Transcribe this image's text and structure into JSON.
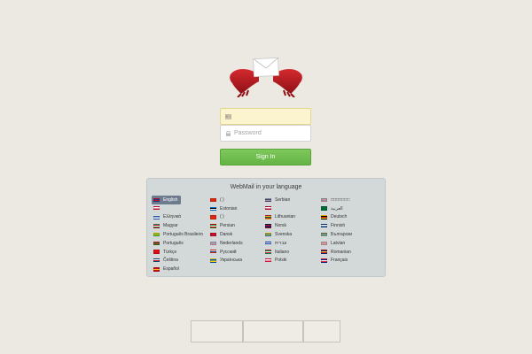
{
  "login": {
    "username_placeholder": "",
    "password_placeholder": "Password",
    "signin_label": "Sign In"
  },
  "languages": {
    "title": "WebMail in your language",
    "active": "English",
    "columns": [
      [
        {
          "label": "English",
          "flag": "uk-flag",
          "colors": [
            "#1f3a8a",
            "#c8102e"
          ]
        },
        {
          "label": "",
          "flag": "korea-flag",
          "colors": [
            "#ffffff",
            "#c8102e"
          ]
        },
        {
          "label": "Ελληνικά",
          "flag": "greece-flag",
          "colors": [
            "#1e5ab8",
            "#ffffff"
          ]
        },
        {
          "label": "Magyar",
          "flag": "hungary-flag",
          "colors": [
            "#c8102e",
            "#ffffff",
            "#3e8e41"
          ]
        },
        {
          "label": "Português Brasileiro",
          "flag": "brazil-flag",
          "colors": [
            "#1fa03c",
            "#f4d000"
          ]
        },
        {
          "label": "Português",
          "flag": "portugal-flag",
          "colors": [
            "#1a7f2a",
            "#d21f1f"
          ]
        },
        {
          "label": "Türkçe",
          "flag": "turkey-flag",
          "colors": [
            "#e30a17",
            "#e30a17"
          ]
        },
        {
          "label": "Čeština",
          "flag": "czech-flag",
          "colors": [
            "#ffffff",
            "#d7141a",
            "#11457e"
          ]
        },
        {
          "label": "Español",
          "flag": "spain-flag",
          "colors": [
            "#c60b1e",
            "#ffc400",
            "#c60b1e"
          ]
        }
      ],
      [
        {
          "label": "( )",
          "flag": "china-flag",
          "colors": [
            "#de2910",
            "#de2910"
          ]
        },
        {
          "label": "Estonian",
          "flag": "estonia-flag",
          "colors": [
            "#0072ce",
            "#000000",
            "#ffffff"
          ]
        },
        {
          "label": "( )",
          "flag": "china-flag",
          "colors": [
            "#de2910",
            "#de2910"
          ]
        },
        {
          "label": "Persian",
          "flag": "iran-flag",
          "colors": [
            "#239f40",
            "#ffffff",
            "#da0000"
          ]
        },
        {
          "label": "Dansk",
          "flag": "denmark-flag",
          "colors": [
            "#c8102e",
            "#c8102e"
          ]
        },
        {
          "label": "Nederlands",
          "flag": "netherlands-flag",
          "colors": [
            "#ae1c28",
            "#ffffff",
            "#21468b"
          ]
        },
        {
          "label": "Русский",
          "flag": "russia-flag",
          "colors": [
            "#ffffff",
            "#0039a6",
            "#d52b1e"
          ]
        },
        {
          "label": "Українська",
          "flag": "ukraine-flag",
          "colors": [
            "#0057b7",
            "#ffd700"
          ]
        }
      ],
      [
        {
          "label": "Serbian",
          "flag": "serbia-flag",
          "colors": [
            "#c6363c",
            "#0c4076",
            "#ffffff"
          ]
        },
        {
          "label": "",
          "flag": "japan-flag",
          "colors": [
            "#ffffff",
            "#bc002d"
          ]
        },
        {
          "label": "Lithuanian",
          "flag": "lithuania-flag",
          "colors": [
            "#fdb913",
            "#006a44",
            "#c1272d"
          ]
        },
        {
          "label": "Norsk",
          "flag": "norway-flag",
          "colors": [
            "#ba0c2f",
            "#00205b"
          ]
        },
        {
          "label": "Svenska",
          "flag": "sweden-flag",
          "colors": [
            "#006aa7",
            "#fecc00"
          ]
        },
        {
          "label": "עברית",
          "flag": "israel-flag",
          "colors": [
            "#ffffff",
            "#0038b8"
          ]
        },
        {
          "label": "Italiano",
          "flag": "italy-flag",
          "colors": [
            "#009246",
            "#ffffff",
            "#ce2b37"
          ]
        },
        {
          "label": "Polski",
          "flag": "poland-flag",
          "colors": [
            "#ffffff",
            "#dc143c"
          ]
        }
      ],
      [
        {
          "label": "□□□□□□□",
          "flag": "thailand-flag",
          "colors": [
            "#a51931",
            "#ffffff",
            "#2d2a4a"
          ]
        },
        {
          "label": "العربية",
          "flag": "arabic-flag",
          "colors": [
            "#006c35",
            "#006c35"
          ]
        },
        {
          "label": "Deutsch",
          "flag": "germany-flag",
          "colors": [
            "#000000",
            "#dd0000",
            "#ffce00"
          ]
        },
        {
          "label": "Finnish",
          "flag": "finland-flag",
          "colors": [
            "#ffffff",
            "#003580"
          ]
        },
        {
          "label": "Български",
          "flag": "bulgaria-flag",
          "colors": [
            "#ffffff",
            "#00966e",
            "#d62612"
          ]
        },
        {
          "label": "Latvian",
          "flag": "latvia-flag",
          "colors": [
            "#9e3039",
            "#ffffff",
            "#9e3039"
          ]
        },
        {
          "label": "Romanian",
          "flag": "romania-flag",
          "colors": [
            "#002b7f",
            "#fcd116",
            "#ce1126"
          ]
        },
        {
          "label": "Français",
          "flag": "france-flag",
          "colors": [
            "#002395",
            "#ffffff",
            "#ed2939"
          ]
        }
      ]
    ]
  },
  "icons": {
    "logo": "envelope-hands-logo",
    "username": "id-card-icon",
    "password": "lock-icon"
  },
  "colors": {
    "background": "#ece9e3",
    "signin": "#6dbb4c",
    "panel": "#d3d8d9",
    "active_language": "#6e7b8e",
    "logo_red": "#b0151d"
  }
}
